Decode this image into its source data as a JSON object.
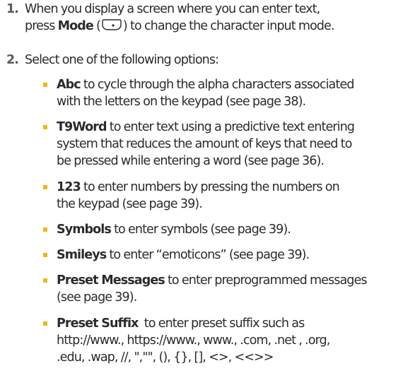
{
  "steps": [
    {
      "number": "1.",
      "line1": "When you display a screen where you can enter text,",
      "line2_pre": "press ",
      "key_label": "Mode",
      "paren_open": " (",
      "paren_close": ")",
      "line2_post": " to change the character input mode.",
      "icon": "mode-key-icon"
    },
    {
      "number": "2.",
      "text": "Select one of the following options:"
    }
  ],
  "options": [
    {
      "term": "Abc",
      "lines": [
        " to cycle through the alpha characters associated",
        "with the letters on the keypad (see page 38)."
      ]
    },
    {
      "term": "T9Word",
      "lines": [
        " to enter text using a predictive text entering",
        "system that reduces the amount of keys that need to",
        "be pressed while entering a word (see page 36)."
      ]
    },
    {
      "term": "123",
      "lines": [
        " to enter numbers by pressing the numbers on",
        "the keypad (see page 39)."
      ]
    },
    {
      "term": "Symbols",
      "lines": [
        " to enter symbols (see page 39)."
      ]
    },
    {
      "term": "Smileys",
      "lines": [
        " to enter “emoticons” (see page 39)."
      ]
    },
    {
      "term": "Preset Messages",
      "lines": [
        " to enter preprogrammed messages",
        "(see page 39)."
      ]
    },
    {
      "term": "Preset Suffix",
      "lines": [
        "  to enter preset suffix such as",
        "http://www., https://www., www., .com, .net , .org,",
        ".edu, .wap, //, \",\"\", (), {}, [], <>, <<>>"
      ]
    }
  ],
  "colors": {
    "bullet": "#f2b705",
    "text": "#2b2b2b",
    "step_number": "#5a5a5a"
  }
}
